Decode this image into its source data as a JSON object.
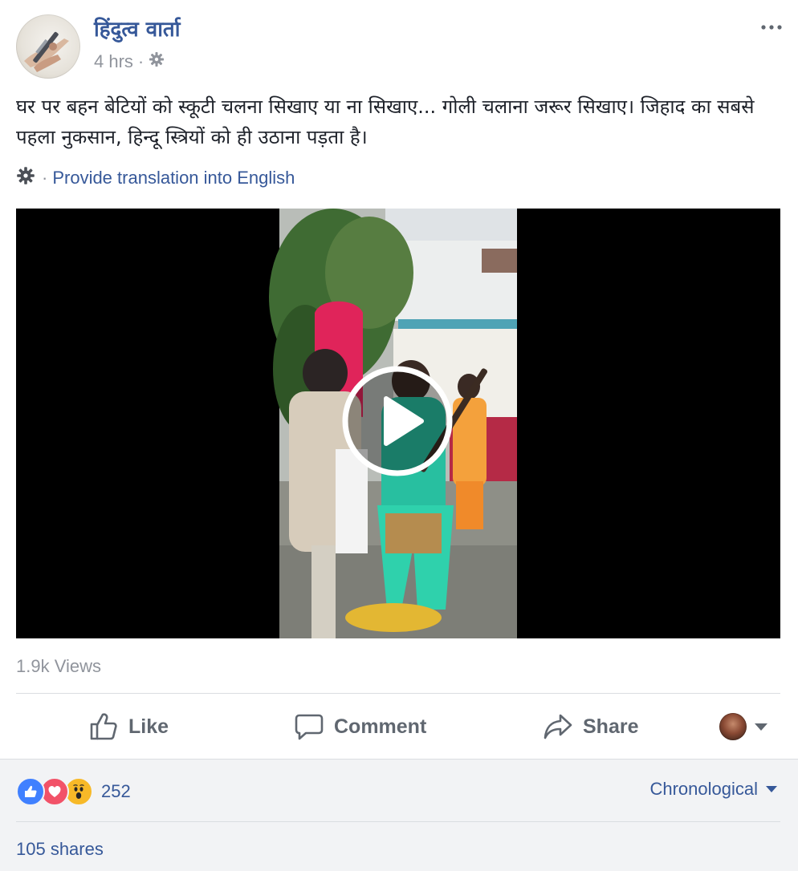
{
  "post": {
    "page_name": "हिंदुत्व वार्ता",
    "time": "4 hrs",
    "time_separator": "·",
    "privacy_icon": "gear-icon",
    "more_icon": "ellipsis-icon",
    "text": "घर पर बहन बेटियों को स्कूटी चलना सिखाए या ना सिखाए... गोली चलाना जरूर सिखाए। जिहाद का सबसे पहला नुकसान, हिन्दू स्त्रियों को ही उठाना पड़ता है।",
    "translate_icon": "gear-icon",
    "translate_separator": "·",
    "translate_link": "Provide translation into English"
  },
  "video": {
    "play_icon": "play-icon",
    "views": "1.9k Views"
  },
  "actions": {
    "like_label": "Like",
    "comment_label": "Comment",
    "share_label": "Share",
    "like_icon": "thumbs-up-icon",
    "comment_icon": "speech-bubble-icon",
    "share_icon": "share-arrow-icon",
    "audience_icon": "chevron-down-icon"
  },
  "footer": {
    "reaction_icons": [
      "like-reaction-icon",
      "love-reaction-icon",
      "wow-reaction-icon"
    ],
    "reaction_count": "252",
    "sort_label": "Chronological",
    "shares": "105 shares"
  },
  "colors": {
    "link": "#365899",
    "muted": "#90949c",
    "action_text": "#606770",
    "footer_bg": "#f2f3f5",
    "like_blue": "#4080ff",
    "love_red": "#f25268",
    "wow_yellow": "#f7b928"
  }
}
